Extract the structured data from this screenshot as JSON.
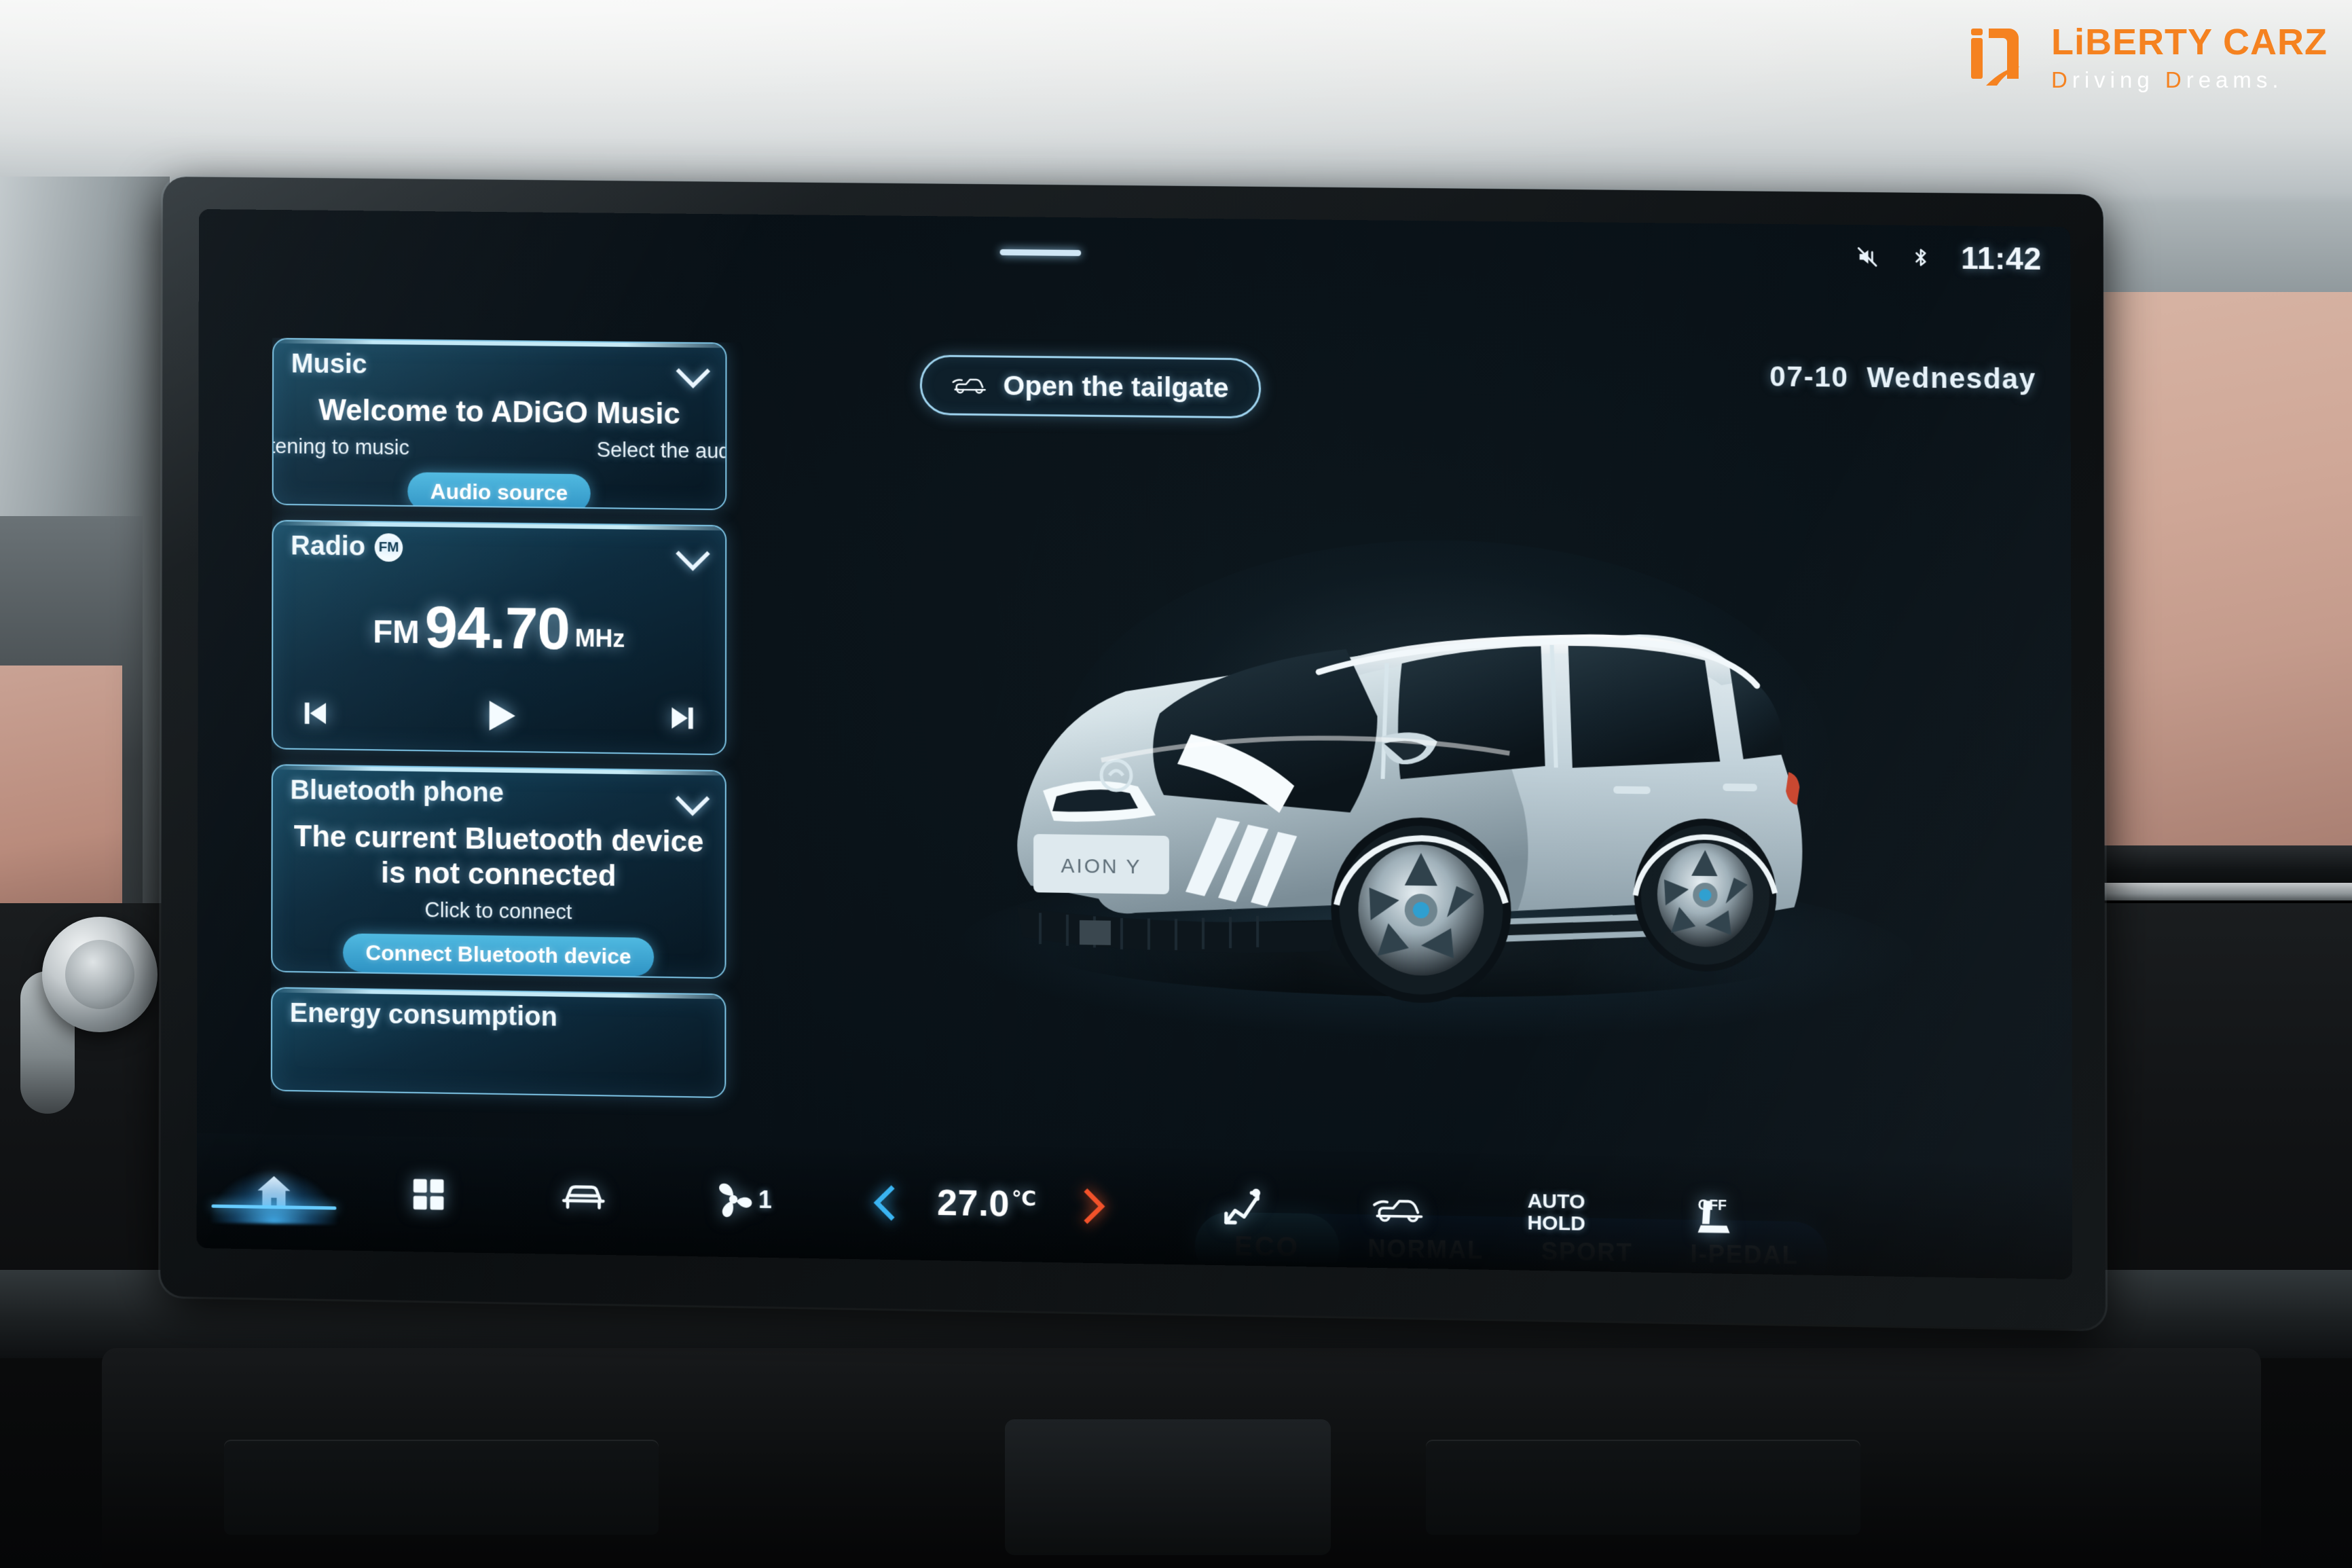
{
  "watermark": {
    "brand_part1": "LiBERTY",
    "brand_part2": " CARZ",
    "tagline_d1": "D",
    "tagline_r1": "riving ",
    "tagline_d2": "D",
    "tagline_r2": "reams.",
    "accent_color": "#f58220",
    "logo_icon": "liberty-carz-logo-icon"
  },
  "status_bar": {
    "mute_icon": "mute-icon",
    "bluetooth_icon": "bluetooth-icon",
    "time": "11:42"
  },
  "date_bar": {
    "date": "07-10",
    "weekday": "Wednesday"
  },
  "tailgate": {
    "icon": "car-tailgate-icon",
    "label": "Open the tailgate"
  },
  "cards": [
    {
      "id": "music",
      "title": "Music",
      "chevron_icon": "chevron-down-icon",
      "headline": "Welcome to ADiGO Music",
      "sub_left": "tening to music",
      "sub_right": "Select the audi",
      "button": "Audio source"
    },
    {
      "id": "radio",
      "title": "Radio",
      "badge": "FM",
      "chevron_icon": "chevron-down-icon",
      "band": "FM",
      "frequency": "94.70",
      "unit": "MHz",
      "prev_icon": "skip-previous-icon",
      "play_icon": "play-icon",
      "next_icon": "skip-next-icon"
    },
    {
      "id": "bluetooth-phone",
      "title": "Bluetooth phone",
      "chevron_icon": "chevron-down-icon",
      "headline": "The current Bluetooth device is not connected",
      "sub": "Click to connect",
      "button": "Connect Bluetooth device"
    },
    {
      "id": "energy-consumption",
      "title": "Energy consumption"
    }
  ],
  "hero": {
    "vehicle_plate": "AION Y",
    "alt": "silver electric MPV three-quarter front view"
  },
  "drive_modes": {
    "active": "ECO",
    "items": [
      {
        "label": "ECO",
        "active": true
      },
      {
        "label": "NORMAL",
        "active": false
      },
      {
        "label": "SPORT",
        "active": false
      },
      {
        "label": "I-PEDAL",
        "active": false
      }
    ]
  },
  "nav_bar": {
    "items": [
      {
        "id": "home",
        "icon": "home-icon",
        "active": true
      },
      {
        "id": "apps",
        "icon": "apps-grid-icon",
        "active": false
      },
      {
        "id": "vehicle",
        "icon": "car-front-icon",
        "active": false
      },
      {
        "id": "fan",
        "icon": "fan-icon",
        "value": "1",
        "active": false
      }
    ],
    "climate": {
      "decrease_icon": "chevron-left-icon",
      "temperature": "27.0",
      "unit": "℃",
      "increase_icon": "chevron-right-icon",
      "decrease_color": "#3ab4f2",
      "increase_color": "#f2522a"
    },
    "right_items": [
      {
        "id": "airflow",
        "icon": "airflow-direction-icon"
      },
      {
        "id": "tailgate",
        "icon": "car-tailgate-icon"
      },
      {
        "id": "auto-hold",
        "icon": "auto-hold-text",
        "line1": "AUTO",
        "line2": "HOLD"
      },
      {
        "id": "seat-heater",
        "icon": "seat-heater-off-icon",
        "label": "OFF"
      }
    ]
  }
}
